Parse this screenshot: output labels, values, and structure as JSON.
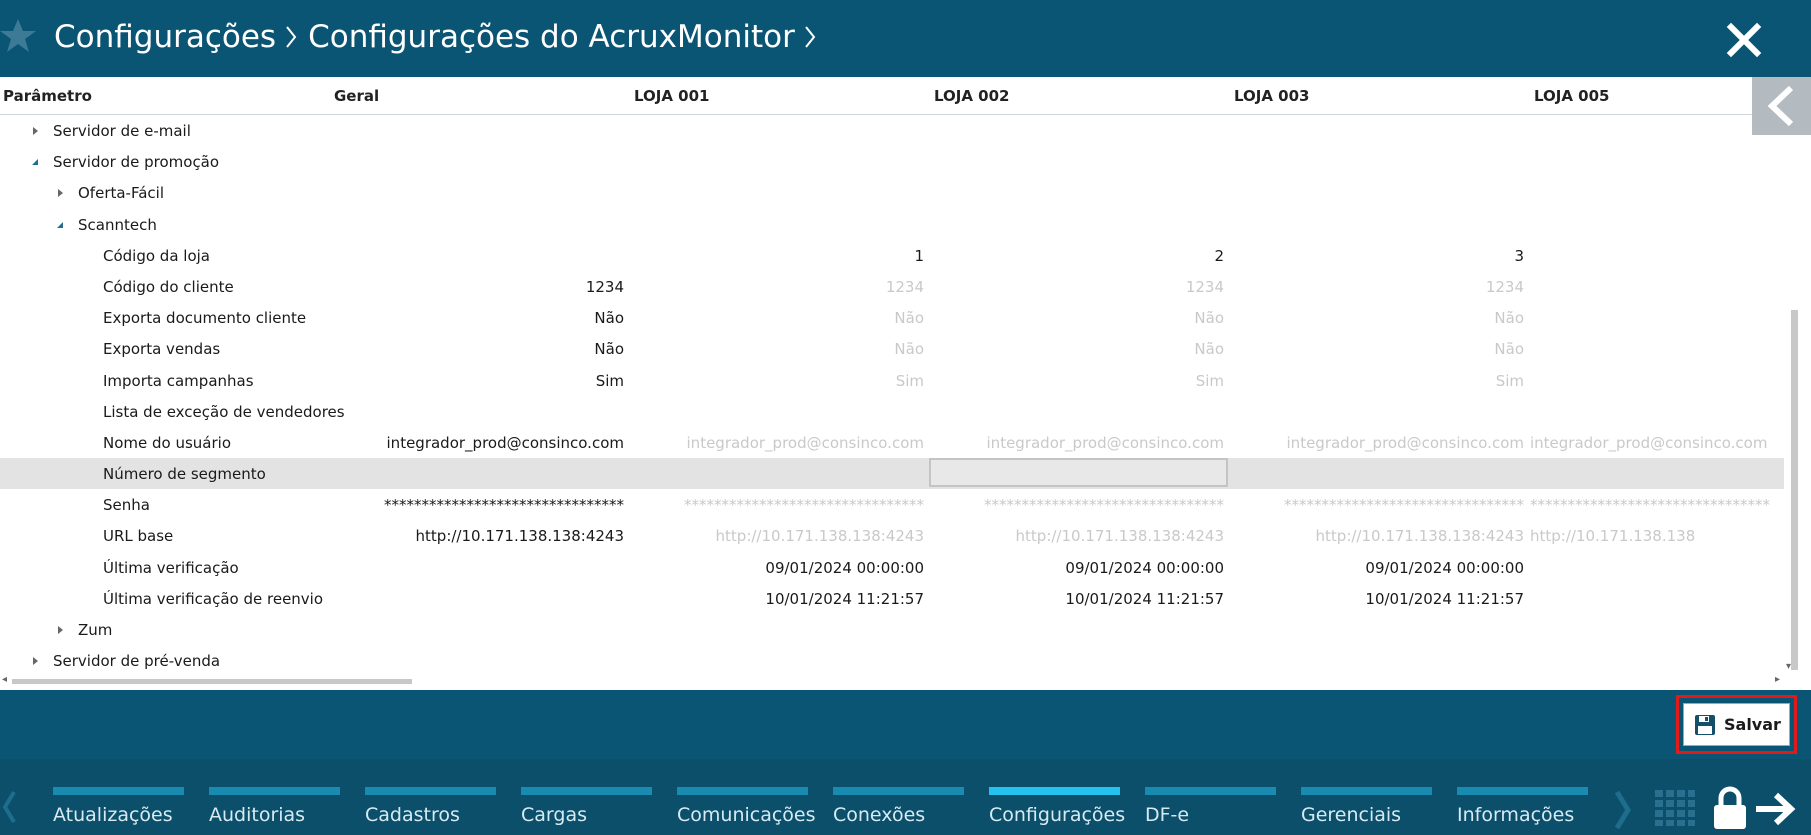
{
  "header": {
    "breadcrumb": [
      "Configurações",
      "Configurações do AcruxMonitor"
    ]
  },
  "columns": [
    "Parâmetro",
    "Geral",
    "LOJA 001",
    "LOJA 002",
    "LOJA 003",
    "LOJA 005"
  ],
  "rows": [
    {
      "label": "Servidor de e-mail",
      "indent": 1,
      "toggle": "collapsed",
      "values": [
        "",
        "",
        "",
        "",
        ""
      ],
      "inherited": [
        false,
        false,
        false,
        false,
        false
      ]
    },
    {
      "label": "Servidor de promoção",
      "indent": 1,
      "toggle": "expanded",
      "values": [
        "",
        "",
        "",
        "",
        ""
      ],
      "inherited": [
        false,
        false,
        false,
        false,
        false
      ]
    },
    {
      "label": "Oferta-Fácil",
      "indent": 2,
      "toggle": "collapsed",
      "values": [
        "",
        "",
        "",
        "",
        ""
      ],
      "inherited": [
        false,
        false,
        false,
        false,
        false
      ]
    },
    {
      "label": "Scanntech",
      "indent": 2,
      "toggle": "expanded",
      "values": [
        "",
        "",
        "",
        "",
        ""
      ],
      "inherited": [
        false,
        false,
        false,
        false,
        false
      ]
    },
    {
      "label": "Código da loja",
      "indent": 3,
      "toggle": "none",
      "values": [
        "",
        "1",
        "2",
        "3",
        ""
      ],
      "inherited": [
        false,
        false,
        false,
        false,
        false
      ]
    },
    {
      "label": "Código do cliente",
      "indent": 3,
      "toggle": "none",
      "values": [
        "1234",
        "1234",
        "1234",
        "1234",
        ""
      ],
      "inherited": [
        false,
        true,
        true,
        true,
        false
      ]
    },
    {
      "label": "Exporta documento cliente",
      "indent": 3,
      "toggle": "none",
      "values": [
        "Não",
        "Não",
        "Não",
        "Não",
        ""
      ],
      "inherited": [
        false,
        true,
        true,
        true,
        false
      ]
    },
    {
      "label": "Exporta vendas",
      "indent": 3,
      "toggle": "none",
      "values": [
        "Não",
        "Não",
        "Não",
        "Não",
        ""
      ],
      "inherited": [
        false,
        true,
        true,
        true,
        false
      ]
    },
    {
      "label": "Importa campanhas",
      "indent": 3,
      "toggle": "none",
      "values": [
        "Sim",
        "Sim",
        "Sim",
        "Sim",
        ""
      ],
      "inherited": [
        false,
        true,
        true,
        true,
        false
      ]
    },
    {
      "label": "Lista de exceção de vendedores",
      "indent": 3,
      "toggle": "none",
      "values": [
        "",
        "",
        "",
        "",
        ""
      ],
      "inherited": [
        false,
        false,
        false,
        false,
        false
      ]
    },
    {
      "label": "Nome do usuário",
      "indent": 3,
      "toggle": "none",
      "values": [
        "integrador_prod@consinco.com",
        "integrador_prod@consinco.com",
        "integrador_prod@consinco.com",
        "integrador_prod@consinco.com",
        "integrador_prod@consinco.com"
      ],
      "inherited": [
        false,
        true,
        true,
        true,
        true
      ]
    },
    {
      "label": "Número de segmento",
      "indent": 3,
      "toggle": "none",
      "selected": true,
      "values": [
        "",
        "",
        "",
        "",
        ""
      ],
      "inherited": [
        false,
        false,
        false,
        false,
        false
      ]
    },
    {
      "label": "Senha",
      "indent": 3,
      "toggle": "none",
      "values": [
        "********************************",
        "********************************",
        "********************************",
        "********************************",
        "********************************"
      ],
      "inherited": [
        false,
        true,
        true,
        true,
        true
      ]
    },
    {
      "label": "URL base",
      "indent": 3,
      "toggle": "none",
      "values": [
        "http://10.171.138.138:4243",
        "http://10.171.138.138:4243",
        "http://10.171.138.138:4243",
        "http://10.171.138.138:4243",
        "http://10.171.138.138"
      ],
      "inherited": [
        false,
        true,
        true,
        true,
        true
      ]
    },
    {
      "label": "Última verificação",
      "indent": 3,
      "toggle": "none",
      "values": [
        "",
        "09/01/2024 00:00:00",
        "09/01/2024 00:00:00",
        "09/01/2024 00:00:00",
        ""
      ],
      "inherited": [
        false,
        false,
        false,
        false,
        false
      ]
    },
    {
      "label": "Última verificação de reenvio",
      "indent": 3,
      "toggle": "none",
      "values": [
        "",
        "10/01/2024 11:21:57",
        "10/01/2024 11:21:57",
        "10/01/2024 11:21:57",
        ""
      ],
      "inherited": [
        false,
        false,
        false,
        false,
        false
      ]
    },
    {
      "label": "Zum",
      "indent": 2,
      "toggle": "collapsed",
      "values": [
        "",
        "",
        "",
        "",
        ""
      ],
      "inherited": [
        false,
        false,
        false,
        false,
        false
      ]
    },
    {
      "label": "Servidor de pré-venda",
      "indent": 1,
      "toggle": "collapsed",
      "values": [
        "",
        "",
        "",
        "",
        ""
      ],
      "inherited": [
        false,
        false,
        false,
        false,
        false
      ]
    }
  ],
  "actions": {
    "save_label": "Salvar"
  },
  "bottom_nav": {
    "items": [
      "Atualizações",
      "Auditorias",
      "Cadastros",
      "Cargas",
      "Comunicações",
      "Conexões",
      "Configurações",
      "DF-e",
      "Gerenciais",
      "Informações"
    ],
    "active": "Configurações"
  },
  "colors": {
    "header_bg": "#0b5574",
    "nav_bar": "#1a8bb0",
    "nav_bar_active": "#23c2ef",
    "highlight_border": "#e21a1a",
    "inherited_text": "#c9c9c9"
  }
}
